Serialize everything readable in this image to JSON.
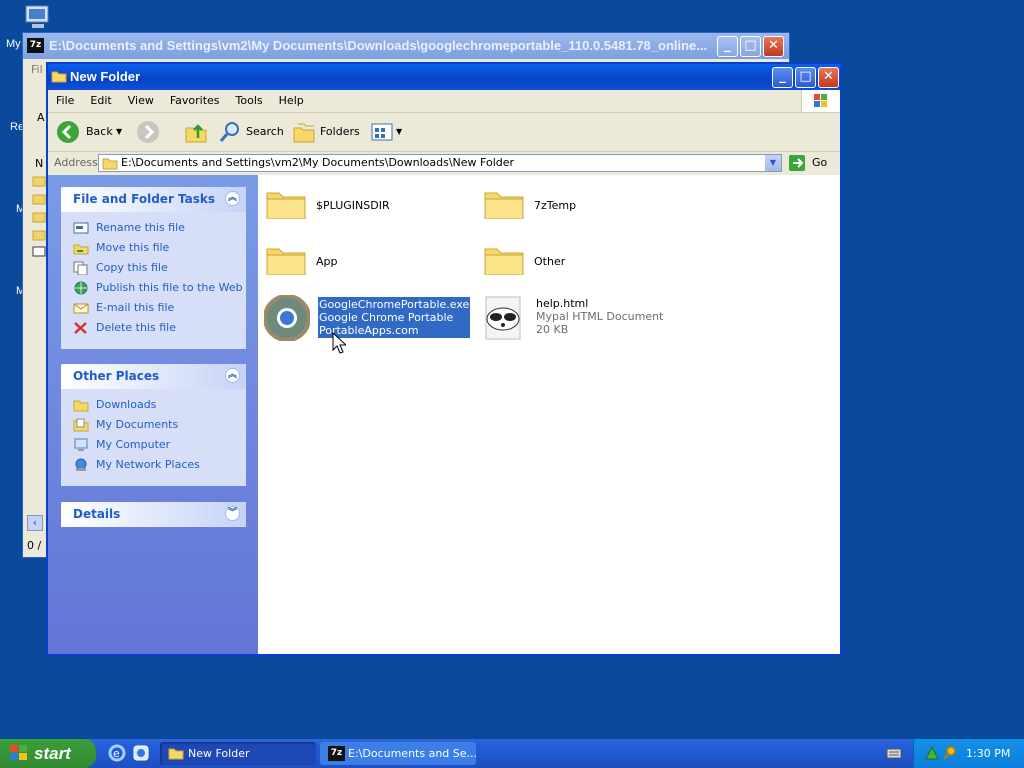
{
  "desktop": {
    "icon_labels": [
      "My",
      "Re",
      "M",
      "M"
    ]
  },
  "bg_window": {
    "title": "E:\\Documents and Settings\\vm2\\My Documents\\Downloads\\googlechromeportable_110.0.5481.78_online...",
    "icon_text": "7z",
    "menu_first": "Fil",
    "row_letters": [
      "A",
      "N"
    ],
    "status": "0 /"
  },
  "window": {
    "title": "New Folder",
    "menu": [
      "File",
      "Edit",
      "View",
      "Favorites",
      "Tools",
      "Help"
    ],
    "toolbar": {
      "back": "Back",
      "search": "Search",
      "folders": "Folders"
    },
    "address": {
      "label": "Address",
      "path": "E:\\Documents and Settings\\vm2\\My Documents\\Downloads\\New Folder",
      "go": "Go"
    }
  },
  "tasks_panel": {
    "title": "File and Folder Tasks",
    "items": [
      "Rename this file",
      "Move this file",
      "Copy this file",
      "Publish this file to the Web",
      "E-mail this file",
      "Delete this file"
    ]
  },
  "places_panel": {
    "title": "Other Places",
    "items": [
      "Downloads",
      "My Documents",
      "My Computer",
      "My Network Places"
    ]
  },
  "details_panel": {
    "title": "Details"
  },
  "files": [
    {
      "name": "$PLUGINSDIR"
    },
    {
      "name": "7zTemp"
    },
    {
      "name": "App"
    },
    {
      "name": "Other"
    },
    {
      "name": "GoogleChromePortable.exe",
      "line2": "Google Chrome Portable",
      "line3": "PortableApps.com"
    },
    {
      "name": "help.html",
      "line2": "Mypal HTML Document",
      "line3": "20 KB"
    }
  ],
  "taskbar": {
    "start": "start",
    "tasks": [
      "New Folder",
      "E:\\Documents and Se..."
    ],
    "clock": "1:30 PM"
  },
  "colors": {
    "accent": "#316ac5",
    "taskbar": "#245edb",
    "link": "#215dc6"
  }
}
